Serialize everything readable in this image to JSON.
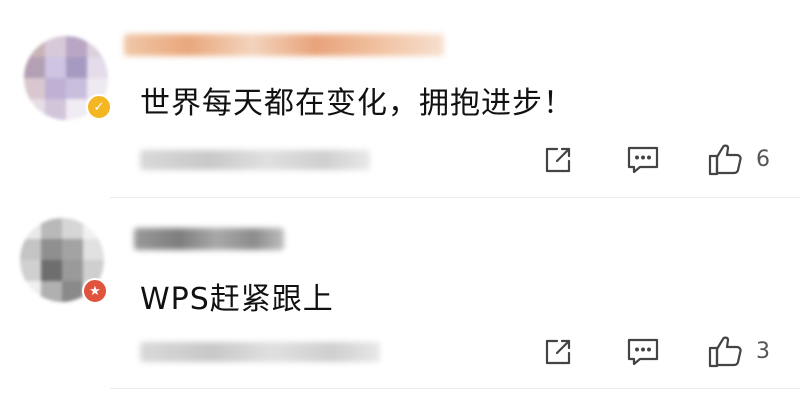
{
  "comments": [
    {
      "text": "世界每天都在变化，拥抱进步！",
      "like_count": "6",
      "badge": {
        "kind": "verified-check",
        "glyph": "✓",
        "color": "#f5b623"
      }
    },
    {
      "text": "WPS赶紧跟上",
      "like_count": "3",
      "badge": {
        "kind": "star-member",
        "glyph": "★",
        "color": "#e0533c"
      }
    }
  ],
  "icons": {
    "share": "share-icon",
    "comment": "comment-icon",
    "like": "thumbs-up-icon"
  },
  "colors": {
    "icon": "#444444",
    "divider": "#ececec",
    "blurred_username": "#e9a77c",
    "blurred_meta": "#cfcfcf"
  }
}
